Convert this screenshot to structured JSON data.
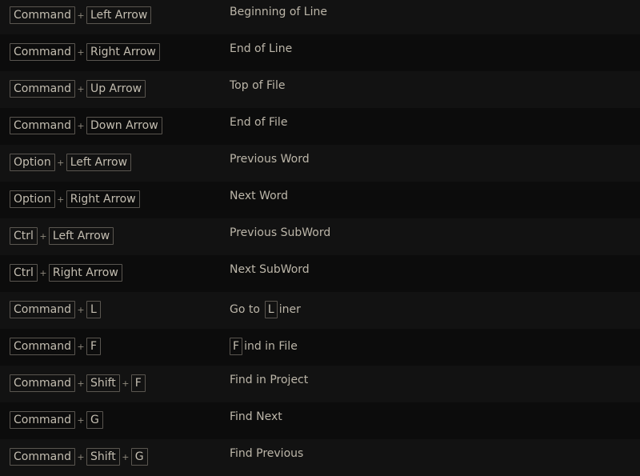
{
  "shortcuts": [
    {
      "keys": [
        "Command",
        "Left Arrow"
      ],
      "action": "Beginning of Line"
    },
    {
      "keys": [
        "Command",
        "Right Arrow"
      ],
      "action": "End of Line"
    },
    {
      "keys": [
        "Command",
        "Up Arrow"
      ],
      "action": "Top of File"
    },
    {
      "keys": [
        "Command",
        "Down Arrow"
      ],
      "action": "End of File"
    },
    {
      "keys": [
        "Option",
        "Left Arrow"
      ],
      "action": "Previous Word"
    },
    {
      "keys": [
        "Option",
        "Right Arrow"
      ],
      "action": "Next Word"
    },
    {
      "keys": [
        "Ctrl",
        "Left Arrow"
      ],
      "action": "Previous SubWord"
    },
    {
      "keys": [
        "Ctrl",
        "Right Arrow"
      ],
      "action": "Next SubWord"
    },
    {
      "keys": [
        "Command",
        "L"
      ],
      "action_prefix": "Go to",
      "action_key": "L",
      "action_suffix": "iner"
    },
    {
      "keys": [
        "Command",
        "F"
      ],
      "action_key": "F",
      "action_suffix": "ind in File"
    },
    {
      "keys": [
        "Command",
        "Shift",
        "F"
      ],
      "action": "Find in Project"
    },
    {
      "keys": [
        "Command",
        "G"
      ],
      "action": "Find Next"
    },
    {
      "keys": [
        "Command",
        "Shift",
        "G"
      ],
      "action": "Find Previous"
    }
  ],
  "separator": "+"
}
